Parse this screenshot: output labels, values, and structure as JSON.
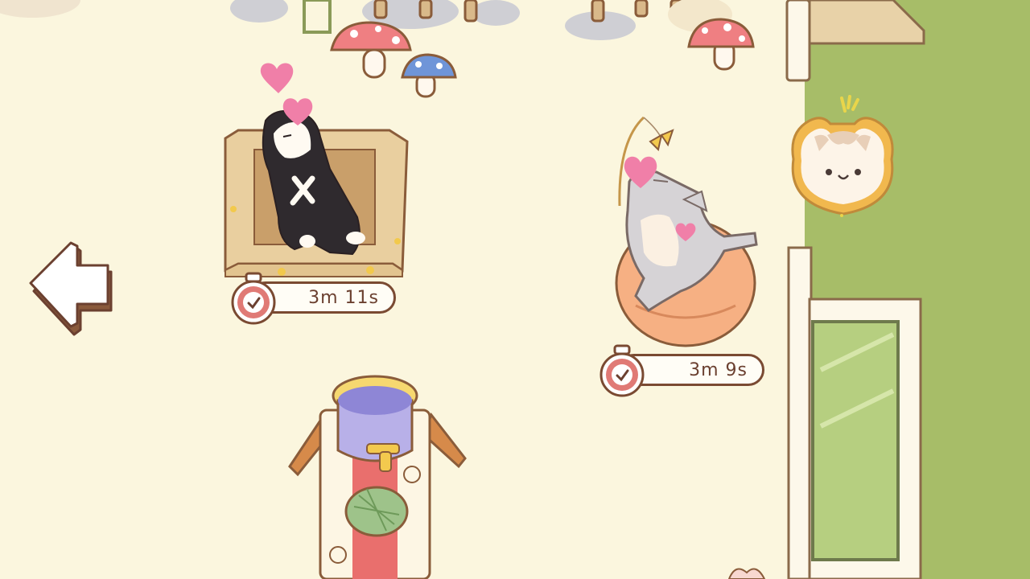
{
  "scene": {
    "cats": [
      {
        "name": "tuxedo-cat",
        "activity": "napping-in-box",
        "timer": "3m 11s"
      },
      {
        "name": "gray-cat",
        "activity": "playing-on-cushion",
        "timer": "3m 9s"
      }
    ]
  },
  "controls": {
    "back_icon": "arrow-left-icon",
    "pet_notice_icon": "bear-face-icon"
  },
  "colors": {
    "floor": "#fbf6de",
    "grass": "#a7bd68",
    "outline": "#7a4a32",
    "timer_red": "#e07a76",
    "heart": "#f07fa8",
    "cushion": "#f6b083",
    "door_glass": "#b6cf80"
  }
}
